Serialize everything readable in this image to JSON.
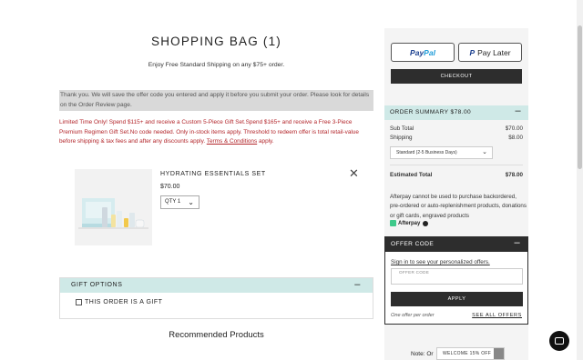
{
  "page": {
    "title": "SHOPPING BAG (1)",
    "subtitle": "Enjoy Free Standard Shipping on any $75+ order.",
    "notice": "Thank you. We will save the offer code you entered and apply it before you submit your order. Please look for details on the Order Review page.",
    "promo_text": "Limited Time Only! Spend $115+ and receive a Custom 5-Piece Gift Set.Spend $165+ and receive a Free 3-Piece Premium Regimen Gift Set.No code needed. Only in-stock items apply. Threshold to redeem offer is total retail-value before shipping & tax fees and after any discounts apply.",
    "promo_link": "Terms & Conditions",
    "promo_tail": " apply."
  },
  "item": {
    "name": "HYDRATING ESSENTIALS SET",
    "price": "$70.00",
    "qty_label": "QTY 1"
  },
  "gift": {
    "header": "GIFT OPTIONS",
    "checkbox_label": "THIS ORDER IS A GIFT"
  },
  "recommended": {
    "title": "Recommended Products"
  },
  "payment": {
    "paypal_pay": "Pay",
    "paypal_pal": "Pal",
    "pay_later_logo": "P",
    "pay_later": "Pay Later",
    "checkout": "CHECKOUT"
  },
  "summary": {
    "header": "ORDER SUMMARY   $78.00",
    "subtotal_label": "Sub Total",
    "subtotal_value": "$70.00",
    "shipping_label": "Shipping",
    "shipping_value": "$8.00",
    "shipping_option": "Standard (2-5 Business Days)",
    "total_label": "Estimated Total",
    "total_value": "$78.00",
    "afterpay_note": "Afterpay cannot be used to purchase backordered, pre-ordered or auto-replenishment products, donations or gift cards, engraved products",
    "afterpay_label": "Afterpay"
  },
  "offer": {
    "header": "OFFER CODE",
    "signin": "Sign in to see your personalized offers.",
    "input_label": "OFFER CODE",
    "apply": "APPLY",
    "one_offer": "One offer per order",
    "see_all": "SEE ALL OFFERS"
  },
  "footer": {
    "note": "Note: Or",
    "welcome": "WELCOME 15% OFF"
  },
  "colors": {
    "accent_mint": "#cfe9e7",
    "dark": "#2d2d2d",
    "promo_red": "#b3262b",
    "paypal_blue": "#1a3f8f"
  }
}
